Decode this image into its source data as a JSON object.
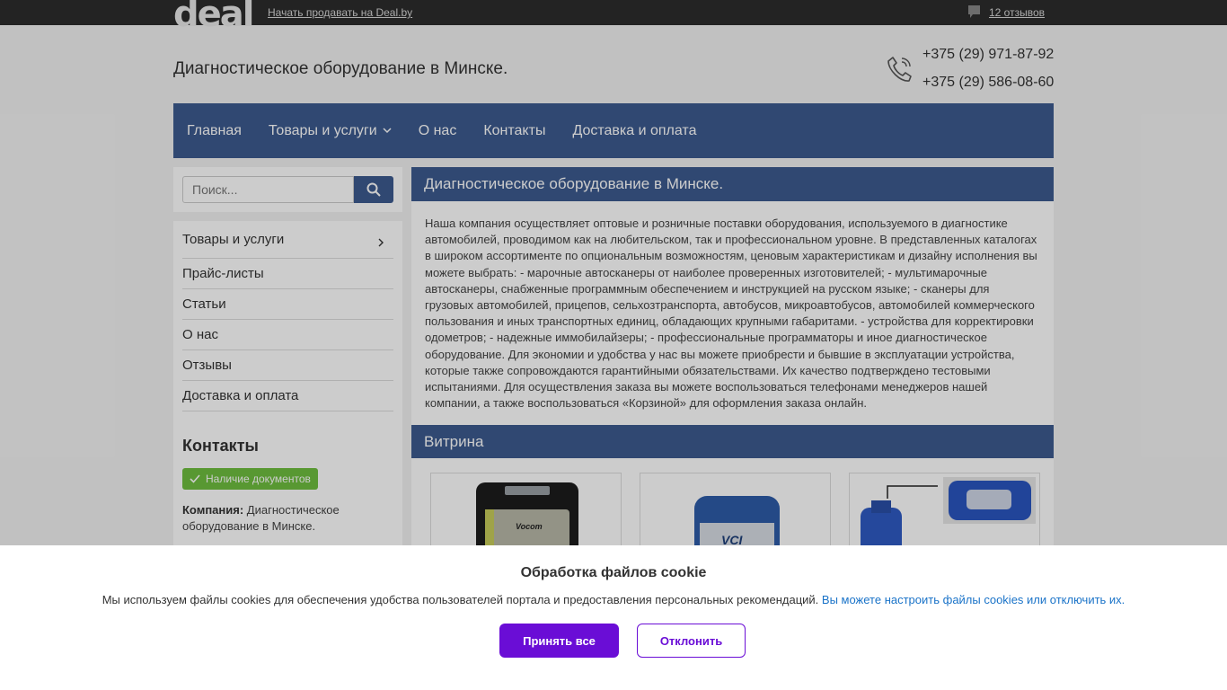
{
  "topbar": {
    "logo": "deal",
    "sell_link": "Начать продавать на Deal.by",
    "reviews": "12 отзывов"
  },
  "header": {
    "title": "Диагностическое оборудование в Минске.",
    "phone1": "+375 (29) 971-87-92",
    "phone2": "+375 (29) 586-08-60"
  },
  "nav": {
    "items": [
      "Главная",
      "Товары и услуги",
      "О нас",
      "Контакты",
      "Доставка и оплата"
    ]
  },
  "search": {
    "placeholder": "Поиск..."
  },
  "sidebar": {
    "items": [
      "Товары и услуги",
      "Прайс-листы",
      "Статьи",
      "О нас",
      "Отзывы",
      "Доставка и оплата"
    ],
    "contacts_heading": "Контакты",
    "docs_badge": "Наличие документов",
    "company_label": "Компания:",
    "company_value": "Диагностическое оборудование в Минске."
  },
  "main": {
    "heading": "Диагностическое оборудование в Минске.",
    "text": "Наша компания осуществляет оптовые и розничные поставки оборудования, используемого в диагностике автомобилей, проводимом как на любительском, так и профессиональном уровне. В представленных каталогах в широком ассортименте по опциональным возможностям, ценовым характеристикам и дизайну исполнения вы можете выбрать: - марочные автосканеры от наиболее проверенных изготовителей; - мультимарочные автосканеры, снабженные программным обеспечением и инструкцией на русском языке; - сканеры для грузовых автомобилей, прицепов, сельхозтранспорта, автобусов, микроавтобусов, автомобилей коммерческого пользования и иных транспортных единиц, обладающих крупными габаритами. - устройства для корректировки одометров; - надежные иммобилайзеры; - профессиональные программаторы и иное диагностическое оборудование. Для экономии и удобства у нас вы можете приобрести и бывшие в эксплуатации устройства, которые также сопровождаются гарантийными обязательствами. Их качество подтверждено тестовыми испытаниями. Для осуществления заказа вы можете воспользоваться телефонами менеджеров нашей компании, а также воспользоваться «Корзиной» для оформления заказа онлайн.",
    "vitrina_heading": "Витрина",
    "product1_label": "Vocom",
    "product2_label": "VCI"
  },
  "cookie": {
    "title": "Обработка файлов cookie",
    "text": "Мы используем файлы cookies для обеспечения удобства пользователей портала и предоставления персональных рекомендаций.",
    "link": "Вы можете настроить файлы cookies или отключить их.",
    "accept": "Принять все",
    "decline": "Отклонить"
  },
  "colors": {
    "nav_bg": "#3c5a8f",
    "topbar_bg": "#2c2c2c",
    "accept_bg": "#6a0dd6",
    "docs_badge_bg": "#6fbf3f",
    "link": "#1a73c8"
  }
}
